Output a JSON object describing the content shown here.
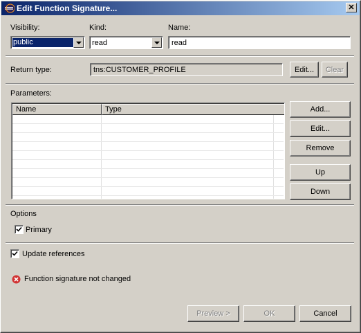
{
  "window": {
    "title": "Edit Function Signature...",
    "close_glyph": "✕",
    "icon": "eclipse-icon"
  },
  "visibility": {
    "label": "Visibility:",
    "value": "public"
  },
  "kind": {
    "label": "Kind:",
    "value": "read"
  },
  "name": {
    "label": "Name:",
    "value": "read"
  },
  "return_type": {
    "label": "Return type:",
    "value": "tns:CUSTOMER_PROFILE",
    "edit_label": "Edit...",
    "clear_label": "Clear"
  },
  "parameters": {
    "label": "Parameters:",
    "columns": [
      "Name",
      "Type"
    ],
    "rows": [],
    "buttons": {
      "add": "Add...",
      "edit": "Edit...",
      "remove": "Remove",
      "up": "Up",
      "down": "Down"
    }
  },
  "options": {
    "label": "Options",
    "primary_label": "Primary",
    "primary_checked": true
  },
  "update_references": {
    "label": "Update references",
    "checked": true
  },
  "status": {
    "message": "Function signature not changed",
    "icon": "error-icon",
    "color": "#d13434"
  },
  "footer": {
    "preview_label": "Preview >",
    "ok_label": "OK",
    "cancel_label": "Cancel"
  },
  "colors": {
    "title_start": "#0a246a",
    "title_end": "#a6caf0",
    "dialog_bg": "#d4d0c8"
  }
}
